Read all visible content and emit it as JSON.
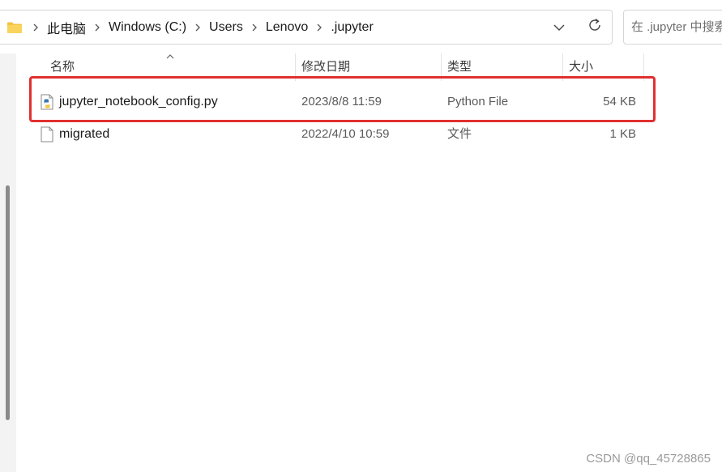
{
  "breadcrumb": {
    "items": [
      "此电脑",
      "Windows (C:)",
      "Users",
      "Lenovo",
      ".jupyter"
    ]
  },
  "search": {
    "placeholder": "在 .jupyter 中搜索"
  },
  "columns": {
    "name": "名称",
    "date": "修改日期",
    "type": "类型",
    "size": "大小"
  },
  "files": [
    {
      "name": "jupyter_notebook_config.py",
      "date": "2023/8/8 11:59",
      "type": "Python File",
      "size": "54 KB",
      "icon": "python-file-icon"
    },
    {
      "name": "migrated",
      "date": "2022/4/10 10:59",
      "type": "文件",
      "size": "1 KB",
      "icon": "blank-file-icon"
    }
  ],
  "colors": {
    "highlight": "#e03030",
    "folder": "#f5c342"
  },
  "watermark": "CSDN @qq_45728865"
}
